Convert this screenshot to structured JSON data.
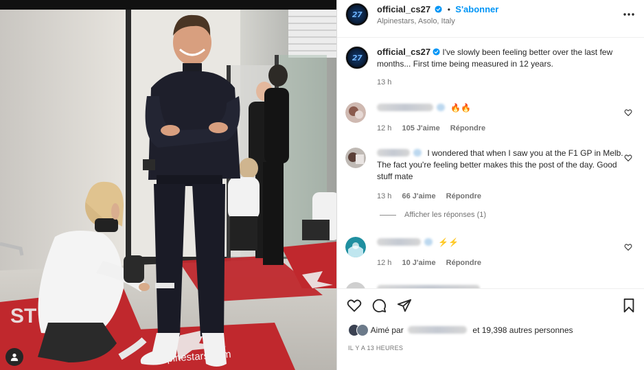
{
  "post": {
    "username": "official_cs27",
    "avatar_text": "27",
    "separator": "•",
    "follow_label": "S'abonner",
    "location": "Alpinestars, Asolo, Italy",
    "caption": "I've slowly been feeling better over the last few months... First time being measured in 12 years.",
    "caption_time": "13 h"
  },
  "photo": {
    "mat_text_left": "ST",
    "mat_text_bottom": "alpinestars.com"
  },
  "comments": [
    {
      "text": "🔥🔥",
      "time": "12 h",
      "likes": "105 J'aime",
      "reply_label": "Répondre"
    },
    {
      "text": "I wondered that when I saw you at the F1 GP in Melb. The fact you're feeling better makes this the post of the day. Good stuff mate",
      "time": "13 h",
      "likes": "66 J'aime",
      "reply_label": "Répondre",
      "view_replies": "Afficher les réponses (1)"
    },
    {
      "text": "⚡⚡",
      "time": "12 h",
      "likes": "10 J'aime",
      "reply_label": "Répondre"
    }
  ],
  "footer": {
    "liked_prefix": "Aimé par",
    "liked_suffix": "et 19,398 autres personnes",
    "time_ago": "IL Y A 13 HEURES"
  },
  "icons": {
    "more": "more-options-icon",
    "verified": "verified-badge-icon",
    "like": "heart-icon",
    "comment": "comment-icon",
    "share": "share-icon",
    "save": "bookmark-icon",
    "tagged_user": "user-icon"
  },
  "colors": {
    "follow_blue": "#0095f6",
    "verified_blue": "#0095f6",
    "muted_text": "#737373",
    "mat_red": "#c0282d"
  }
}
